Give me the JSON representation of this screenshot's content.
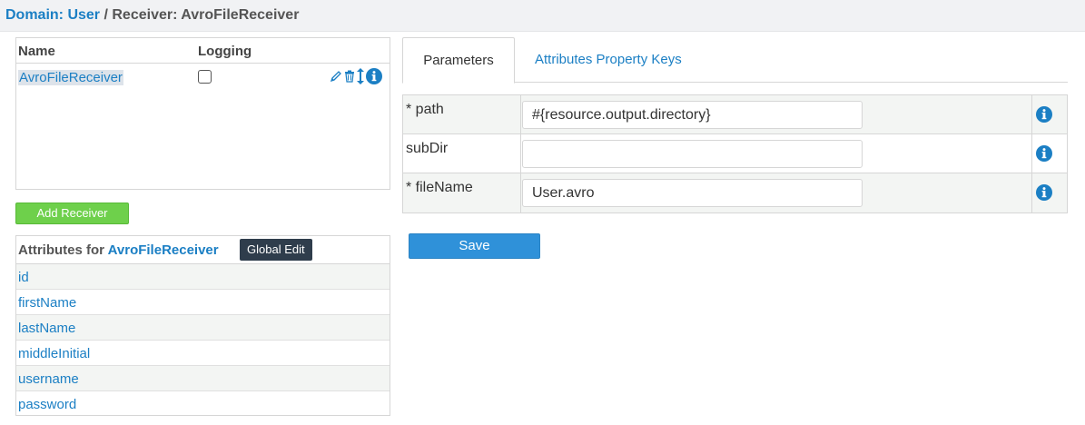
{
  "breadcrumb": {
    "domain_prefix": "Domain: ",
    "domain_name": "User",
    "separator": " / ",
    "receiver_text": "Receiver: AvroFileReceiver"
  },
  "receivers_table": {
    "col_name": "Name",
    "col_logging": "Logging",
    "rows": [
      {
        "name": "AvroFileReceiver",
        "logging": false
      }
    ]
  },
  "add_receiver_label": "Add Receiver",
  "attributes_panel": {
    "title_prefix": "Attributes for ",
    "title_receiver": "AvroFileReceiver",
    "global_edit_label": "Global Edit",
    "items": [
      "id",
      "firstName",
      "lastName",
      "middleInitial",
      "username",
      "password"
    ]
  },
  "tabs": [
    {
      "label": "Parameters",
      "active": true
    },
    {
      "label": "Attributes Property Keys",
      "active": false
    }
  ],
  "parameters": [
    {
      "label": "* path",
      "value": "#{resource.output.directory}"
    },
    {
      "label": "subDir",
      "value": ""
    },
    {
      "label": "* fileName",
      "value": "User.avro"
    }
  ],
  "save_label": "Save",
  "colors": {
    "link": "#1b7fc4",
    "add_button": "#6ed04b",
    "save_button": "#2f91d9",
    "global_edit_button": "#2f3d4c"
  },
  "icons": {
    "edit": "pencil-icon",
    "delete": "trash-icon",
    "reorder": "move-vertical-icon",
    "info": "info-circle-icon"
  }
}
